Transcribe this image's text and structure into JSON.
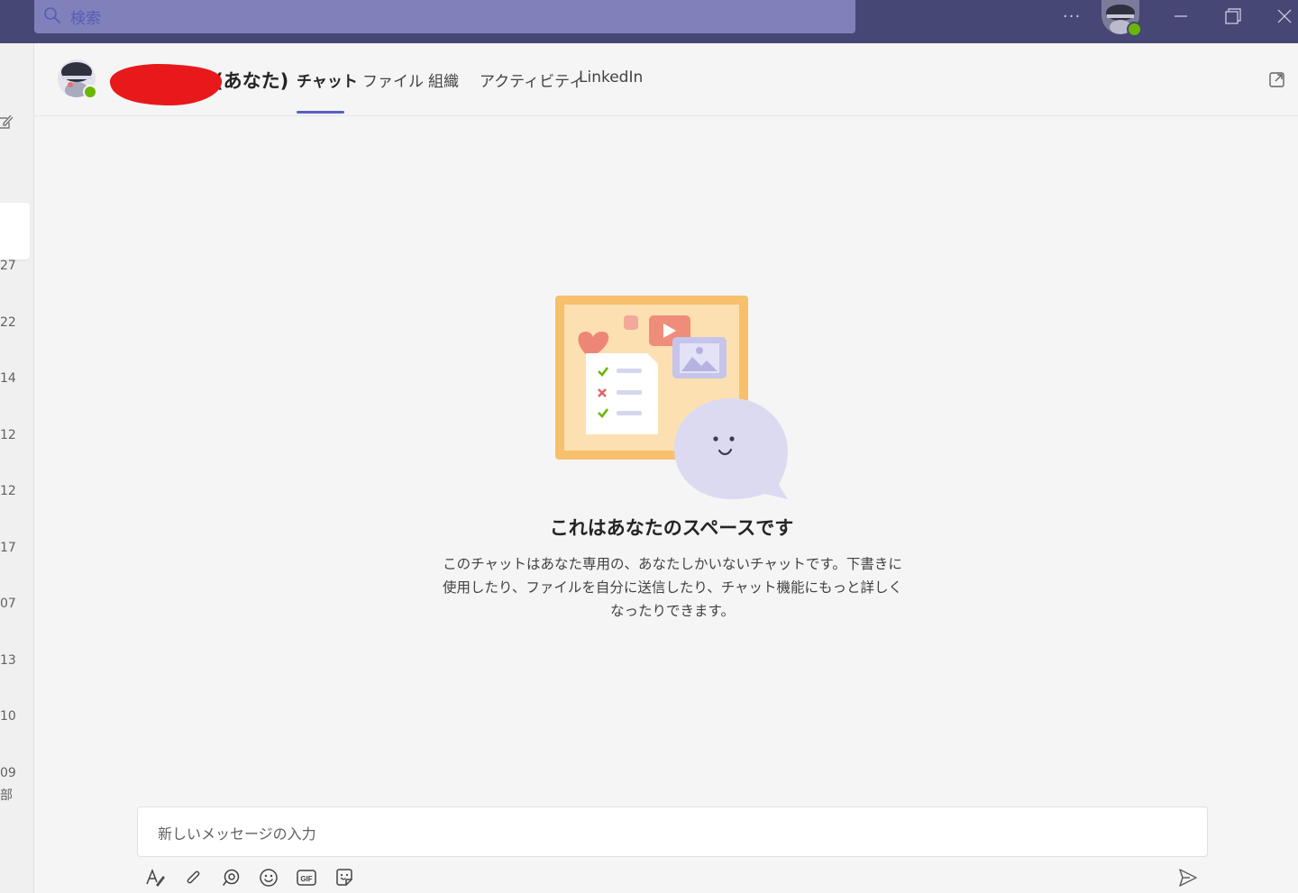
{
  "titlebar": {
    "search_placeholder": "検索",
    "more_label": "···",
    "presence_color": "#6bb700",
    "background": "#464775"
  },
  "left_strip": {
    "items": [
      "27",
      "22",
      "14",
      "12",
      "12",
      "17",
      "07",
      "13",
      "10",
      "09"
    ],
    "last_item_sub": "部"
  },
  "header": {
    "name_suffix": "(あなた)",
    "tabs": [
      "チャット",
      "ファイル",
      "組織",
      "アクティビティ",
      "LinkedIn"
    ],
    "active_tab": "チャット",
    "accent": "#5b5fc7"
  },
  "empty_state": {
    "title": "これはあなたのスペースです",
    "description": "このチャットはあなた専用の、あなたしかいないチャットです。下書きに使用したり、ファイルを自分に送信したり、チャット機能にもっと詳しくなったりできます。"
  },
  "compose": {
    "placeholder": "新しいメッセージの入力",
    "toolbar_icons": [
      "format-icon",
      "attach-icon",
      "loop-icon",
      "emoji-icon",
      "gif-icon",
      "sticker-icon"
    ],
    "send_icon": "send-icon"
  }
}
